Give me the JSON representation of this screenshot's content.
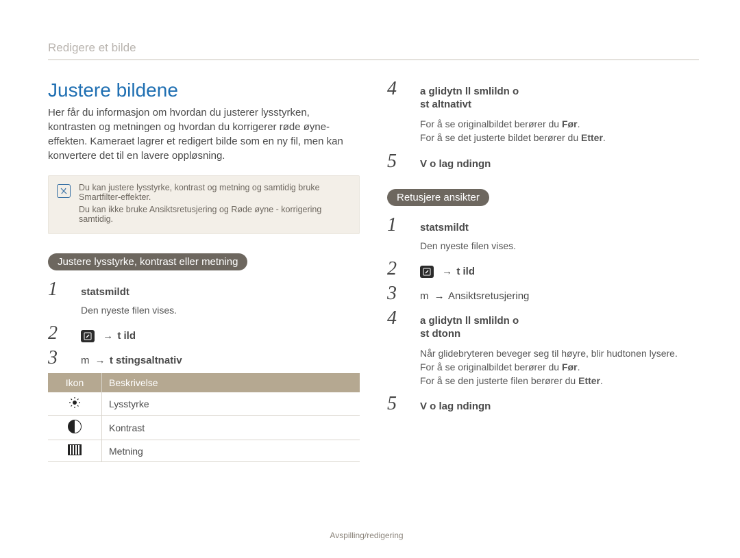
{
  "breadcrumb": "Redigere et bilde",
  "heading": "Justere bildene",
  "intro": "Her får du informasjon om hvordan du justerer lysstyrken, kontrasten og metningen og hvordan du korrigerer røde øyne-effekten. Kameraet lagrer et redigert bilde som en ny fil, men kan konvertere det til en lavere oppløsning.",
  "note": {
    "line1": "Du kan justere lysstyrke, kontrast og metning og samtidig bruke Smartfilter-effekter.",
    "line2": "Du kan ikke bruke Ansiktsretusjering og Røde øyne - korrigering samtidig."
  },
  "section1": {
    "pill": "Justere lysstyrke, kontrast eller metning",
    "step1_head": "statsmildt",
    "step1_sub": "Den nyeste filen vises.",
    "step2_tail": "t ild",
    "step3_prefix": "m",
    "step3_target": "t stingsaltnativ",
    "table": {
      "h_icon": "Ikon",
      "h_desc": "Beskrivelse",
      "r1": "Lysstyrke",
      "r2": "Kontrast",
      "r3": "Metning"
    }
  },
  "section2": {
    "step4_line1": "a glidytn ll  smlildn o",
    "step4_line2": "st altnativt",
    "step4_sub1_a": "For å se originalbildet berører du ",
    "step4_sub1_b": "Før",
    "step4_sub2_a": "For å se det justerte bildet berører du ",
    "step4_sub2_b": "Etter",
    "step5": "V   o  lag ndingn"
  },
  "section3": {
    "pill": "Retusjere ansikter",
    "step1_head": "statsmildt",
    "step1_sub": "Den nyeste filen vises.",
    "step2_tail": "t ild",
    "step3_prefix": "m",
    "step3_target": "Ansiktsretusjering",
    "step4_line1": "a glidytn ll  smlildn o",
    "step4_line2": "st dtonn",
    "step4_sub0": "Når glidebryteren beveger seg til høyre, blir hudtonen lysere.",
    "step4_sub1_a": "For å se originalbildet berører du ",
    "step4_sub1_b": "Før",
    "step4_sub2_a": "For å se den justerte filen berører du ",
    "step4_sub2_b": "Etter",
    "step5": "V   o  lag ndingn"
  },
  "footer": {
    "label": "Avspilling/redigering",
    "page": ""
  }
}
